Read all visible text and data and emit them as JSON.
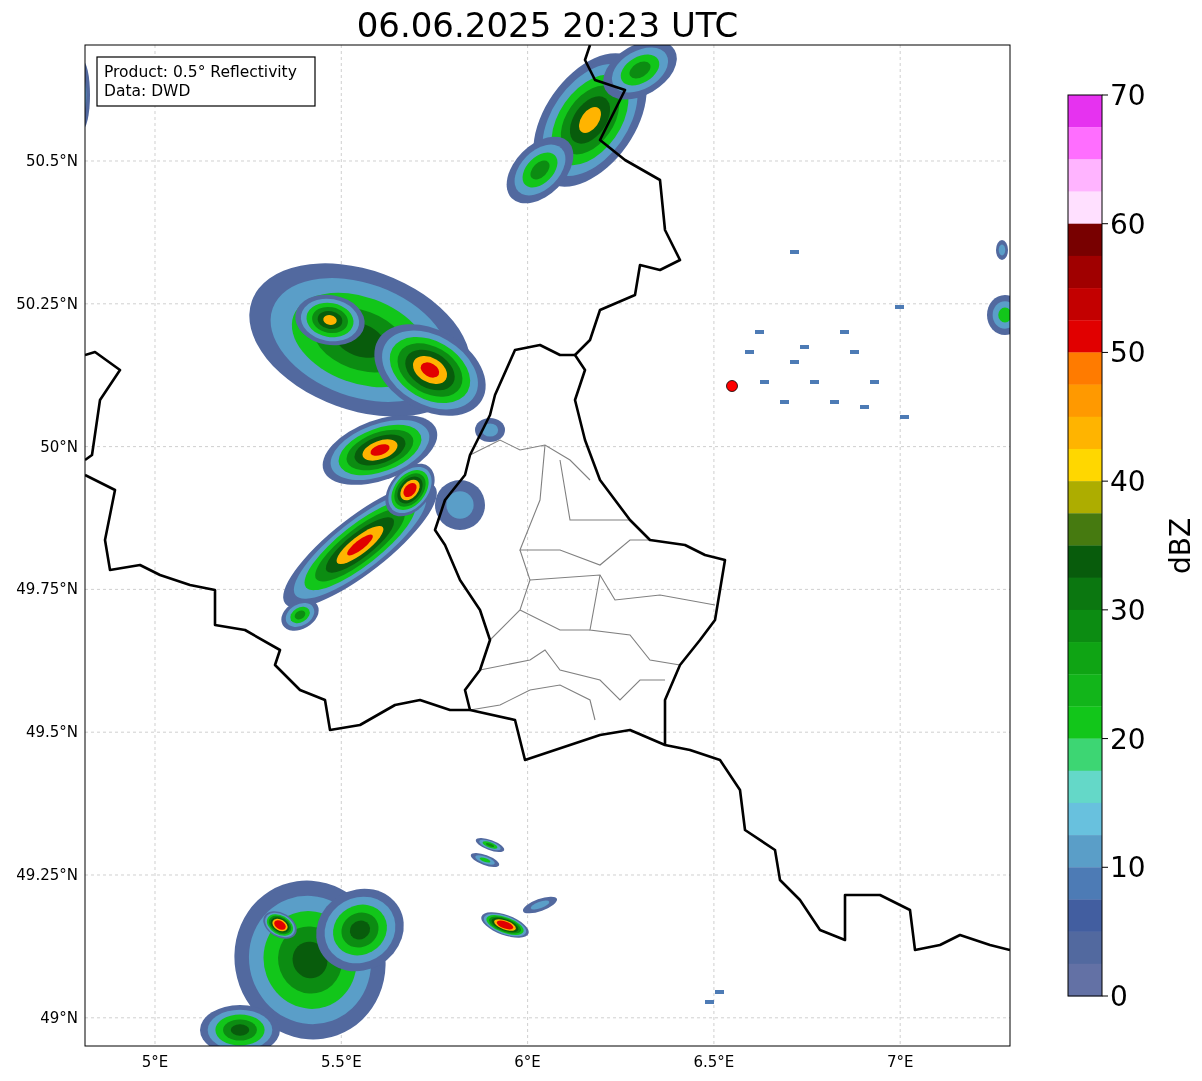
{
  "title": "06.06.2025 20:23 UTC",
  "info_box": {
    "lines": [
      "Product: 0.5° Reflectivity",
      "Data: DWD"
    ]
  },
  "lat_ticks": [
    "50.5°N",
    "50.25°N",
    "50°N",
    "49.75°N",
    "49.5°N",
    "49.25°N",
    "49°N"
  ],
  "lon_ticks": [
    "5°E",
    "5.5°E",
    "6°E",
    "6.5°E",
    "7°E"
  ],
  "colorbar": {
    "label": "dBZ",
    "ticks": [
      "70",
      "60",
      "50",
      "40",
      "30",
      "20",
      "10",
      "0"
    ],
    "bins": [
      {
        "color": "#e632f0"
      },
      {
        "color": "#ff6eff"
      },
      {
        "color": "#ffb4ff"
      },
      {
        "color": "#ffe0ff"
      },
      {
        "color": "#780000"
      },
      {
        "color": "#a00000"
      },
      {
        "color": "#c30000"
      },
      {
        "color": "#e10000"
      },
      {
        "color": "#ff7b00"
      },
      {
        "color": "#ff9900"
      },
      {
        "color": "#ffb400"
      },
      {
        "color": "#ffd700"
      },
      {
        "color": "#adad00"
      },
      {
        "color": "#467a10"
      },
      {
        "color": "#085c0c"
      },
      {
        "color": "#0b7710"
      },
      {
        "color": "#0c8c12"
      },
      {
        "color": "#0fa414"
      },
      {
        "color": "#12b51a"
      },
      {
        "color": "#12c61a"
      },
      {
        "color": "#3dd673"
      },
      {
        "color": "#64d8c8"
      },
      {
        "color": "#68c1de"
      },
      {
        "color": "#5a9ec8"
      },
      {
        "color": "#4d7bb5"
      },
      {
        "color": "#425ea0"
      },
      {
        "color": "#52699f"
      },
      {
        "color": "#6371a5"
      }
    ]
  }
}
